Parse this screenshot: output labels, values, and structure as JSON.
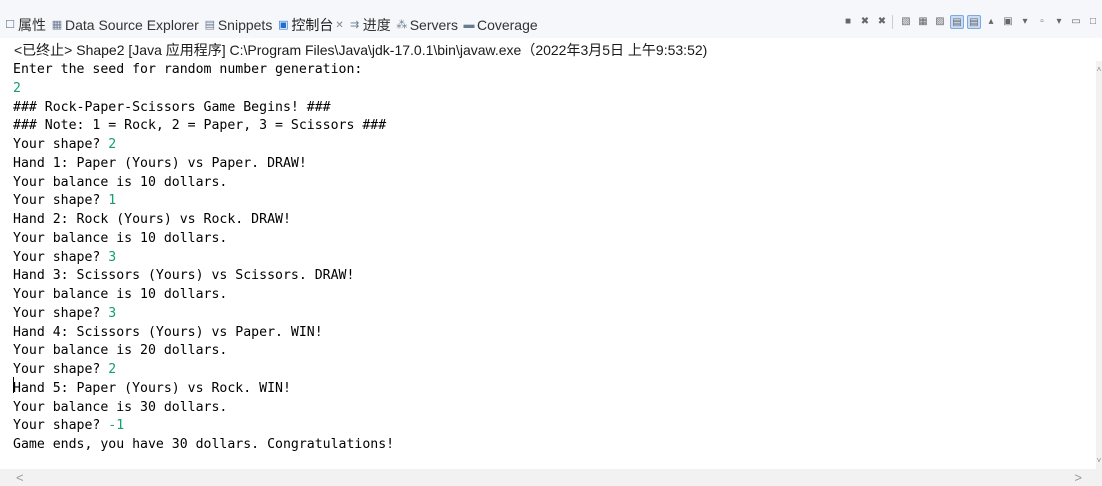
{
  "tabs": [
    {
      "icon": "properties-icon",
      "glyph": "☐",
      "label": "属性",
      "active": false
    },
    {
      "icon": "data-source-explorer-icon",
      "glyph": "▦",
      "label": "Data Source Explorer",
      "active": false
    },
    {
      "icon": "snippets-icon",
      "glyph": "▤",
      "label": "Snippets",
      "active": false
    },
    {
      "icon": "console-icon",
      "glyph": "▣",
      "label": "控制台",
      "active": true,
      "close": "✕"
    },
    {
      "icon": "progress-icon",
      "glyph": "⇉",
      "label": "进度",
      "active": false
    },
    {
      "icon": "servers-icon",
      "glyph": "⁂",
      "label": "Servers",
      "active": false
    },
    {
      "icon": "coverage-icon",
      "glyph": "▬",
      "label": "Coverage",
      "active": false
    }
  ],
  "status": "<已终止> Shape2 [Java 应用程序] C:\\Program Files\\Java\\jdk-17.0.1\\bin\\javaw.exe（2022年3月5日 上午9:53:52)",
  "console": [
    {
      "text": "Enter the seed for random number generation:"
    },
    {
      "text": "",
      "input": "2"
    },
    {
      "text": "### Rock-Paper-Scissors Game Begins! ###"
    },
    {
      "text": "### Note: 1 = Rock, 2 = Paper, 3 = Scissors ###"
    },
    {
      "text": "Your shape? ",
      "input": "2"
    },
    {
      "text": "Hand 1: Paper (Yours) vs Paper. DRAW!"
    },
    {
      "text": "Your balance is 10 dollars."
    },
    {
      "text": "Your shape? ",
      "input": "1"
    },
    {
      "text": "Hand 2: Rock (Yours) vs Rock. DRAW!"
    },
    {
      "text": "Your balance is 10 dollars."
    },
    {
      "text": "Your shape? ",
      "input": "3"
    },
    {
      "text": "Hand 3: Scissors (Yours) vs Scissors. DRAW!"
    },
    {
      "text": "Your balance is 10 dollars."
    },
    {
      "text": "Your shape? ",
      "input": "3"
    },
    {
      "text": "Hand 4: Scissors (Yours) vs Paper. WIN!"
    },
    {
      "text": "Your balance is 20 dollars."
    },
    {
      "text": "Your shape? ",
      "input": "2"
    },
    {
      "text": "Hand 5: Paper (Yours) vs Rock. WIN!"
    },
    {
      "text": "Your balance is 30 dollars."
    },
    {
      "text": "Your shape? ",
      "input": "-1"
    },
    {
      "text": "Game ends, you have 30 dollars. Congratulations!"
    }
  ],
  "colors": {
    "input": "#14a06a",
    "active_accent": "#1f6fd1"
  }
}
